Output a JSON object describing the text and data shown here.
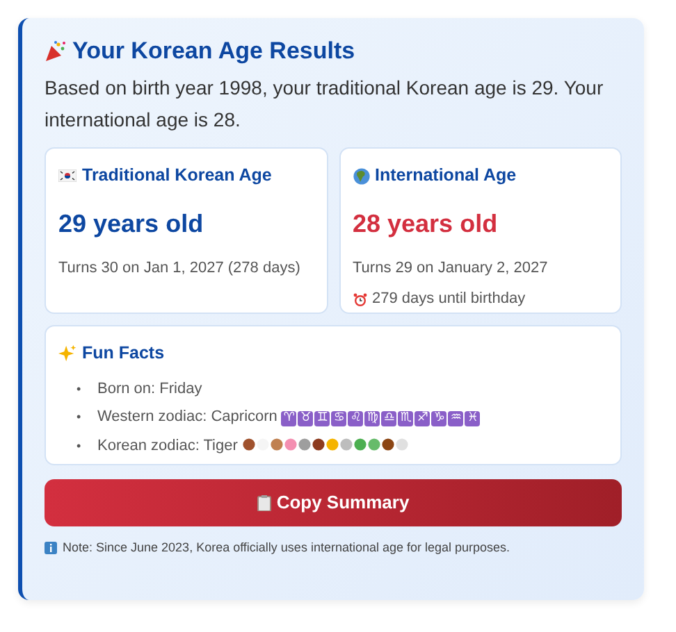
{
  "title": "Your Korean Age Results",
  "summary": "Based on birth year 1998, your traditional Korean age is 29. Your international age is 28.",
  "age_cards": [
    {
      "kind": "korean",
      "heading": "Traditional Korean Age",
      "age": "29 years old",
      "lines": [
        "Turns 30 on Jan 1, 2027 (278 days)"
      ]
    },
    {
      "kind": "international",
      "heading": "International Age",
      "age": "28 years old",
      "lines": [
        "Turns 29 on January 2, 2027",
        "279 days until birthday"
      ]
    }
  ],
  "fun_facts": {
    "heading": "Fun Facts",
    "items": [
      {
        "kind": "plain",
        "bullet": "•",
        "text": "Born on: Friday"
      },
      {
        "kind": "zodiac",
        "bullet": "•",
        "text": "Western zodiac: Capricorn",
        "signs": [
          "♈",
          "♉",
          "♊",
          "♋",
          "♌",
          "♍",
          "♎",
          "♏",
          "♐",
          "♑",
          "♒",
          "♓"
        ]
      },
      {
        "kind": "animals",
        "bullet": "•",
        "text": "Korean zodiac: Tiger"
      }
    ]
  },
  "copy_button": "Copy Summary",
  "note": "Note: Since June 2023, Korea officially uses international age for legal purposes."
}
